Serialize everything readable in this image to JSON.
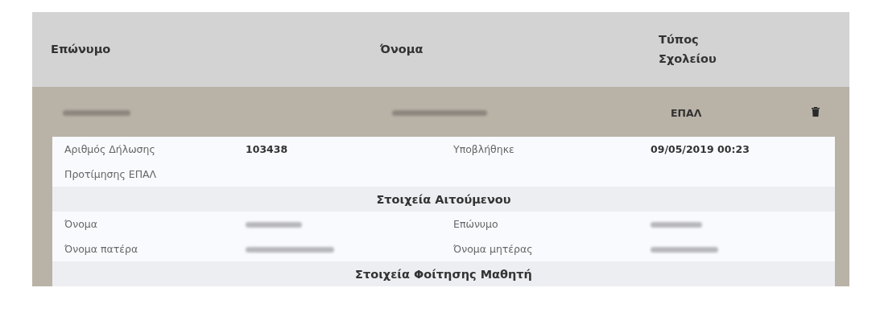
{
  "table": {
    "columns": [
      {
        "label": "Επώνυμο"
      },
      {
        "label": "Όνομα"
      },
      {
        "label": "Τύπος Σχολείου"
      }
    ],
    "rows": [
      {
        "cells": [
          {
            "redacted": true
          },
          {
            "redacted": true
          },
          {
            "text": "ΕΠΑΛ",
            "redacted": false
          }
        ],
        "expanded": true,
        "details": [
          {
            "kind": "pair",
            "label": "Αριθμός Δήλωσης",
            "value": {
              "text": "103438",
              "redacted": false
            },
            "label2": "Υποβλήθηκε",
            "value2": {
              "text": "09/05/2019 00:23",
              "redacted": false
            }
          },
          {
            "kind": "pair",
            "label": "Προτίμησης ΕΠΑΛ"
          },
          {
            "kind": "section",
            "title": "Στοιχεία Αιτούμενου"
          },
          {
            "kind": "pair",
            "label": "Όνομα",
            "value": {
              "redacted": true
            },
            "label2": "Επώνυμο",
            "value2": {
              "redacted": true
            }
          },
          {
            "kind": "pair",
            "label": "Όνομα πατέρα",
            "value": {
              "redacted": true
            },
            "label2": "Όνομα μητέρας",
            "value2": {
              "redacted": true
            }
          },
          {
            "kind": "section",
            "title": "Στοιχεία Φοίτησης Μαθητή"
          }
        ]
      }
    ]
  }
}
